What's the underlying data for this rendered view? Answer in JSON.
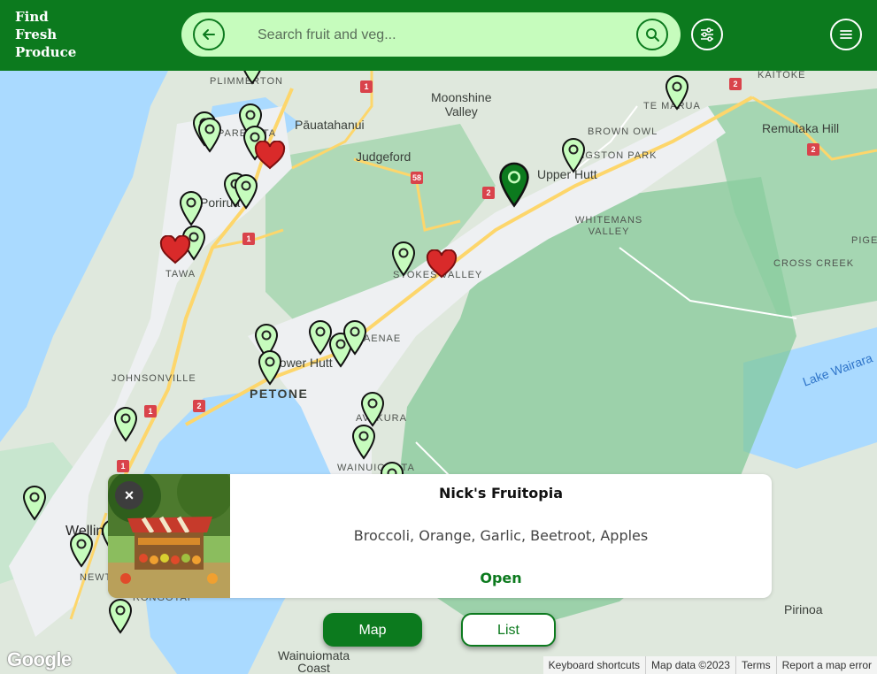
{
  "header": {
    "logo_lines": [
      "Find",
      "Fresh",
      "Produce"
    ],
    "search_placeholder": "Search fruit and veg...",
    "back_icon": "arrow-left-icon",
    "search_icon": "search-icon",
    "filter_icon": "sliders-icon",
    "menu_icon": "hamburger-menu-icon"
  },
  "map": {
    "labels": {
      "plimmerton": "PLIMMERTON",
      "moonshine": "Moonshine\nValley",
      "te_marua": "TE MARUA",
      "kaitoke": "KAITOKE",
      "pauatahanui": "Pāuatahanui",
      "paremata": "PAREMATA",
      "brown_owl": "BROWN OWL",
      "remutaka": "Remutaka Hill",
      "judgeford": "Judgeford",
      "kingston_park": "KINGSTON PARK",
      "upper_hutt": "Upper Hutt",
      "porirua": "Porirua",
      "whitemans": "WHITEMANS\nVALLEY",
      "pigeon": "PIGE",
      "tawa": "TAWA",
      "stokes": "STOKES VALLEY",
      "cross_creek": "CROSS CREEK",
      "naenae": "NAENAE",
      "lower_hutt": "Lower Hutt",
      "johnsonville": "JOHNSONVILLE",
      "petone": "PETONE",
      "lake": "Lake Wairara",
      "avalon": "AVAKURA",
      "wainuiomata": "WAINUIOMATA",
      "wellington": "Wellington",
      "newtown": "NEWTOWN",
      "rongotai": "RONGOTAI",
      "pirinoa": "Pirinoa",
      "wainuiomata_coast": "Wainuiomata\nCoast"
    },
    "highway_numbers": [
      "1",
      "2",
      "2",
      "58",
      "2",
      "1",
      "1",
      "2",
      "2",
      "1"
    ],
    "google_logo": "Google",
    "attribution": [
      "Keyboard shortcuts",
      "Map data ©2023",
      "Terms",
      "Report a map error"
    ],
    "colors": {
      "water": "#aadaff",
      "land": "#dfe8dd",
      "forest": "#7fc794",
      "urban": "#eef0f2",
      "road": "#fdd66b",
      "pin_fill": "#c6fcbd",
      "pin_outline": "#111111",
      "selected_pin": "#0c7a1e",
      "heart": "#d92a2a"
    }
  },
  "selected_stall": {
    "name": "Nick's Fruitopia",
    "items": "Broccoli, Orange, Garlic, Beetroot, Apples",
    "status": "Open",
    "close_label": "×"
  },
  "view_toggle": {
    "map_label": "Map",
    "list_label": "List"
  }
}
